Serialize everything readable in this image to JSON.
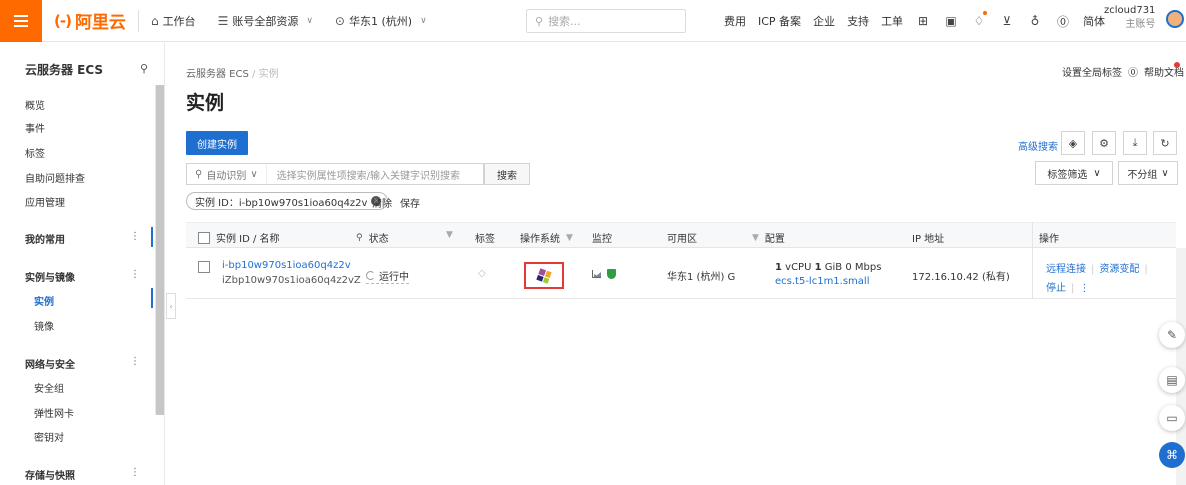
{
  "topbar": {
    "logo_text": "阿里云",
    "logo_mark": "(-)",
    "workbench": "工作台",
    "account_resources": "账号全部资源",
    "region": "华东1 (杭州)",
    "search_placeholder": "搜索...",
    "links": [
      "费用",
      "ICP 备案",
      "企业",
      "支持",
      "工单"
    ],
    "lang": "简体",
    "username": "zcloud731",
    "role": "主账号"
  },
  "sidebar": {
    "title": "云服务器 ECS",
    "items": [
      {
        "label": "概览"
      },
      {
        "label": "事件"
      },
      {
        "label": "标签"
      },
      {
        "label": "自助问题排查"
      },
      {
        "label": "应用管理"
      }
    ],
    "groups": [
      {
        "label": "我的常用"
      },
      {
        "label": "实例与镜像"
      },
      {
        "label": "网络与安全"
      },
      {
        "label": "存储与快照"
      }
    ],
    "image_items": [
      {
        "label": "实例"
      },
      {
        "label": "镜像"
      }
    ],
    "network_items": [
      {
        "label": "安全组"
      },
      {
        "label": "弹性网卡"
      },
      {
        "label": "密钥对"
      }
    ]
  },
  "main": {
    "breadcrumb_root": "云服务器 ECS",
    "breadcrumb_sep": "/",
    "breadcrumb_current": "实例",
    "page_title": "实例",
    "global_tags": "设置全局标签",
    "help_docs": "帮助文档",
    "create_button": "创建实例",
    "advanced_search": "高级搜索",
    "filter_select": "自动识别",
    "filter_placeholder": "选择实例属性项搜索/输入关键字识别搜索",
    "search_button": "搜索",
    "tag_filter": "标签筛选",
    "group_filter": "不分组",
    "chip_label": "实例 ID：i-bp10w970s1ioa60q4z2v",
    "clear": "清除",
    "save": "保存"
  },
  "table": {
    "headers": {
      "id_name": "实例 ID / 名称",
      "status": "状态",
      "tag": "标签",
      "os": "操作系统",
      "monitor": "监控",
      "zone": "可用区",
      "config": "配置",
      "ip": "IP 地址",
      "actions": "操作"
    },
    "rows": [
      {
        "id": "i-bp10w970s1ioa60q4z2v",
        "name": "iZbp10w970s1ioa60q4z2vZ",
        "status": "运行中",
        "zone": "华东1 (杭州) G",
        "config_cpu_num": "1",
        "config_cpu_unit": "vCPU",
        "config_mem_num": "1",
        "config_mem_unit": "GiB",
        "config_bw": "0 Mbps",
        "instance_type": "ecs.t5-lc1m1.small",
        "ip": "172.16.10.42 (私有)",
        "actions": [
          "远程连接",
          "资源变配",
          "停止"
        ]
      }
    ]
  },
  "colors": {
    "accent": "#ff6a00",
    "primary": "#1f6fd1",
    "highlight": "#e53935"
  }
}
